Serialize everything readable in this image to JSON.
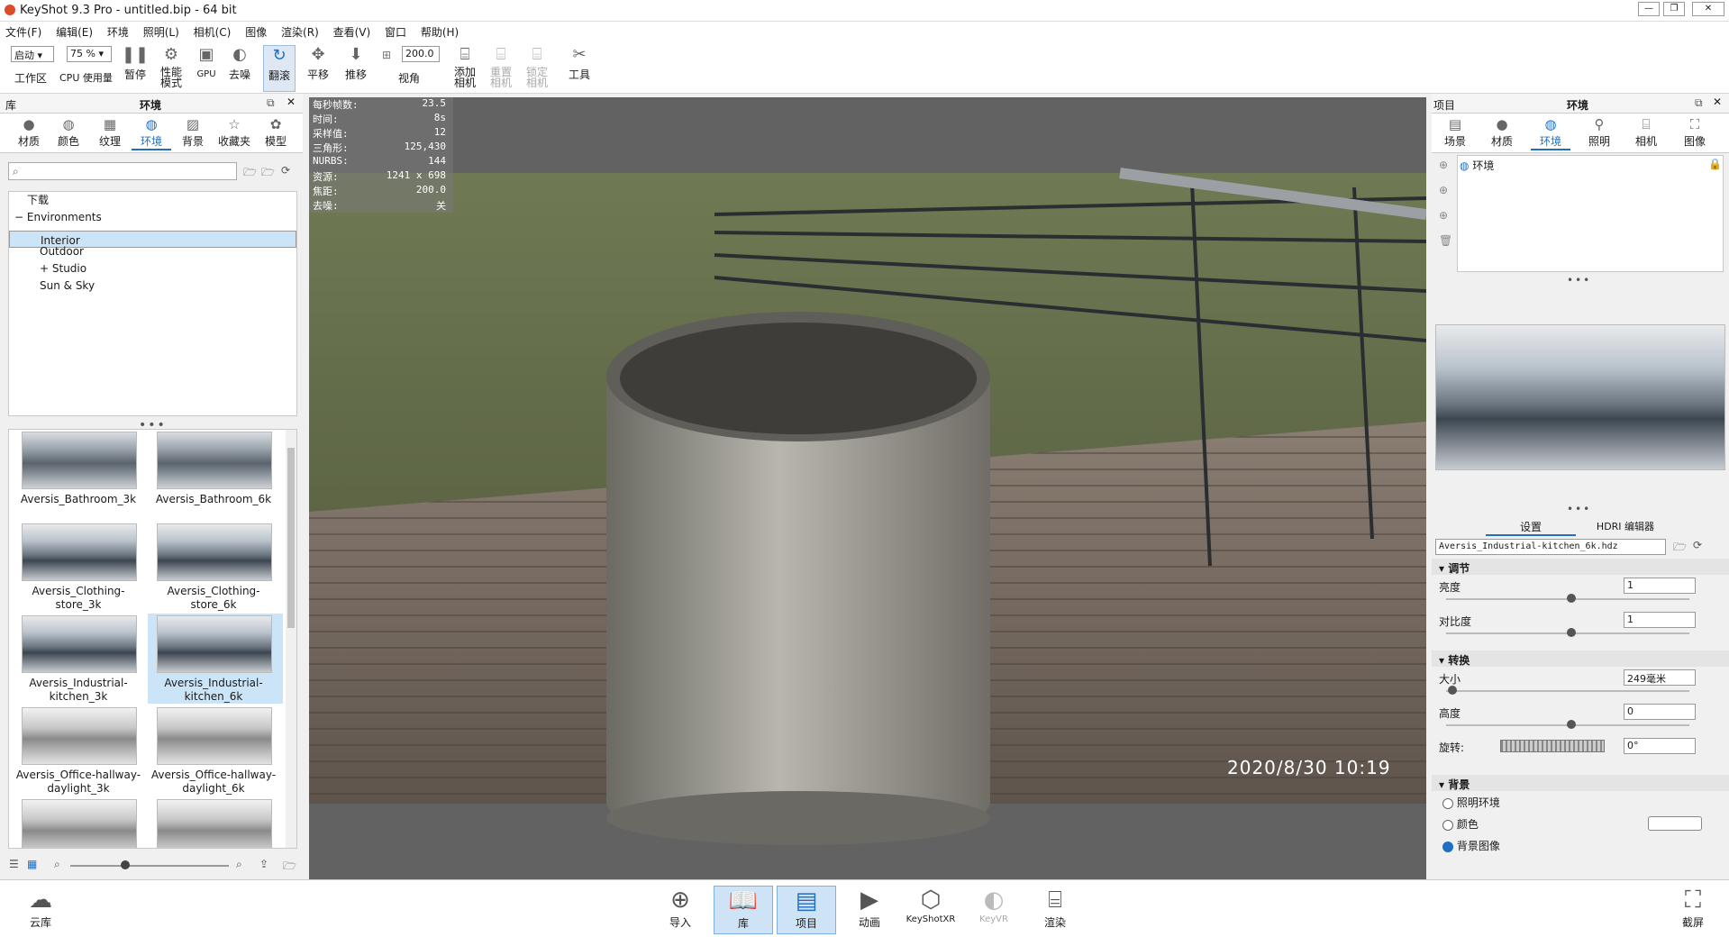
{
  "app": {
    "title": "KeyShot 9.3 Pro  - untitled.bip  - 64 bit"
  },
  "menu": [
    "文件(F)",
    "编辑(E)",
    "环境",
    "照明(L)",
    "相机(C)",
    "图像",
    "渲染(R)",
    "查看(V)",
    "窗口",
    "帮助(H)"
  ],
  "toolbar": {
    "workspace_value": "启动",
    "workspace_label": "工作区",
    "cpu_value": "75 %",
    "cpu_label": "CPU 使用量",
    "pause": "暂停",
    "perf_mode": "性能\n模式",
    "gpu": "GPU",
    "denoise": "去噪",
    "tumble": "翻滚",
    "pan": "平移",
    "dolly": "推移",
    "fov_value": "200.0",
    "fov_label": "视角",
    "add_camera": "添加\n相机",
    "reset_camera": "重置\n相机",
    "lock_camera": "锁定\n相机",
    "tools": "工具"
  },
  "library": {
    "panel_title": "库",
    "tab_title": "环境",
    "tabs": [
      "材质",
      "颜色",
      "纹理",
      "环境",
      "背景",
      "收藏夹",
      "模型"
    ],
    "active_tab": "环境",
    "search_placeholder": "",
    "tree": [
      {
        "label": "下载",
        "indent": 1
      },
      {
        "label": "Environments",
        "indent": 0,
        "expand": "−"
      },
      {
        "label": "Interior",
        "indent": 2,
        "selected": true
      },
      {
        "label": "Outdoor",
        "indent": 2
      },
      {
        "label": "Studio",
        "indent": 2,
        "expand": "+"
      },
      {
        "label": "Sun & Sky",
        "indent": 2
      }
    ],
    "thumbnails": [
      {
        "label": "Aversis_Bathroom_3k"
      },
      {
        "label": "Aversis_Bathroom_6k"
      },
      {
        "label": "Aversis_Clothing-\nstore_3k"
      },
      {
        "label": "Aversis_Clothing-\nstore_6k"
      },
      {
        "label": "Aversis_Industrial-\nkitchen_3k"
      },
      {
        "label": "Aversis_Industrial-\nkitchen_6k",
        "selected": true
      },
      {
        "label": "Aversis_Office-hallway-\ndaylight_3k"
      },
      {
        "label": "Aversis_Office-hallway-\ndaylight_6k"
      },
      {
        "label": ""
      },
      {
        "label": ""
      }
    ]
  },
  "stats": {
    "rows": [
      {
        "k": "每秒帧数:",
        "v": "23.5"
      },
      {
        "k": "时间:",
        "v": "8s"
      },
      {
        "k": "采样值:",
        "v": "12"
      },
      {
        "k": "三角形:",
        "v": "125,430"
      },
      {
        "k": "NURBS:",
        "v": "144"
      },
      {
        "k": "资源:",
        "v": "1241 x 698"
      },
      {
        "k": "焦距:",
        "v": "200.0"
      },
      {
        "k": "去噪:",
        "v": "关"
      }
    ]
  },
  "viewport": {
    "timestamp": "2020/8/30  10:19"
  },
  "project": {
    "panel_title": "项目",
    "tab_title": "环境",
    "tabs": [
      "场景",
      "材质",
      "环境",
      "照明",
      "相机",
      "图像"
    ],
    "active_tab": "环境",
    "env_list": [
      "环境"
    ],
    "subtabs": [
      "设置",
      "HDRI 编辑器"
    ],
    "file_name": "Aversis_Industrial-kitchen_6k.hdz",
    "adjust": {
      "title": "调节",
      "brightness_label": "亮度",
      "brightness": "1",
      "contrast_label": "对比度",
      "contrast": "1"
    },
    "transform": {
      "title": "转换",
      "size_label": "大小",
      "size": "249毫米",
      "height_label": "高度",
      "height": "0",
      "rotation_label": "旋转:",
      "rotation": "0°"
    },
    "background": {
      "title": "背景",
      "options": [
        "照明环境",
        "颜色",
        "背景图像"
      ],
      "selected": "背景图像"
    }
  },
  "bottom": {
    "cloud": "云库",
    "import": "导入",
    "library": "库",
    "project": "项目",
    "animation": "动画",
    "keyshotxr": "KeyShotXR",
    "keyvr": "KeyVR",
    "render": "渲染",
    "screenshot": "截屏"
  }
}
